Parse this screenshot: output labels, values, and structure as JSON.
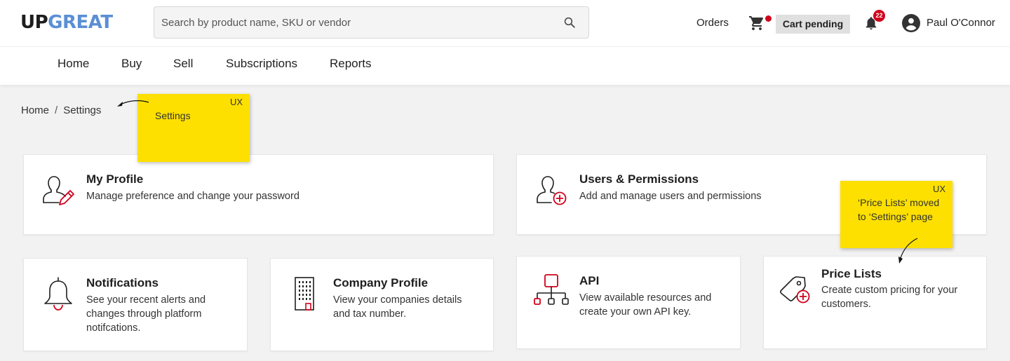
{
  "header": {
    "logo_part1": "UP",
    "logo_part2": "GREAT",
    "search_placeholder": "Search by product name, SKU or vendor",
    "orders_label": "Orders",
    "cart_pending_label": "Cart pending",
    "notification_count": "22",
    "user_name": "Paul O'Connor"
  },
  "nav": {
    "items": [
      {
        "label": "Home"
      },
      {
        "label": "Buy"
      },
      {
        "label": "Sell"
      },
      {
        "label": "Subscriptions"
      },
      {
        "label": "Reports"
      }
    ]
  },
  "breadcrumb": {
    "home": "Home",
    "separator": "/",
    "current": "Settings"
  },
  "cards": {
    "my_profile": {
      "title": "My Profile",
      "desc": "Manage preference and change your password",
      "icon": "user-edit-icon"
    },
    "users_permissions": {
      "title": "Users & Permissions",
      "desc": "Add and manage users and permissions",
      "icon": "user-add-icon"
    },
    "notifications": {
      "title": "Notifications",
      "desc": "See your recent alerts and changes through platform notifcations.",
      "icon": "bell-icon"
    },
    "company_profile": {
      "title": "Company Profile",
      "desc": "View your companies details and tax number.",
      "icon": "building-icon"
    },
    "api": {
      "title": "API",
      "desc": "View available resources and create your own API key.",
      "icon": "api-network-icon"
    },
    "price_lists": {
      "title": "Price Lists",
      "desc": "Create custom pricing for your customers.",
      "icon": "price-tag-add-icon"
    }
  },
  "sticky_notes": {
    "settings_note": {
      "tag": "UX",
      "text": "Settings"
    },
    "price_lists_note": {
      "tag": "UX",
      "text": "‘Price Lists’ moved to ‘Settings’ page"
    }
  },
  "colors": {
    "accent_red": "#d0021b",
    "logo_blue": "#5b8fd4",
    "sticky_yellow": "#fde000",
    "page_background": "#f2f2f2"
  }
}
